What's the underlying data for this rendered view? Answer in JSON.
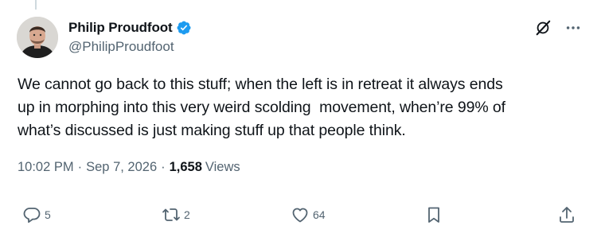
{
  "author": {
    "display_name": "Philip Proudfoot",
    "handle": "@PhilipProudfoot",
    "verified": true,
    "verified_color": "#1d9bf0"
  },
  "tweet": {
    "text": "We cannot go back to this stuff; when the left is in retreat it always ends\nup in morphing into this very weird scolding  movement, when’re 99% of\nwhat’s discussed is just making stuff up that people think.",
    "time": "10:02 PM",
    "date": "Sep 7, 2026",
    "views_count": "1,658",
    "views_label": "Views"
  },
  "actions": {
    "reply_count": "5",
    "repost_count": "2",
    "like_count": "64"
  },
  "icons": [
    "verified-badge-icon",
    "grok-icon",
    "more-icon",
    "reply-icon",
    "repost-icon",
    "like-icon",
    "bookmark-icon",
    "share-icon"
  ]
}
